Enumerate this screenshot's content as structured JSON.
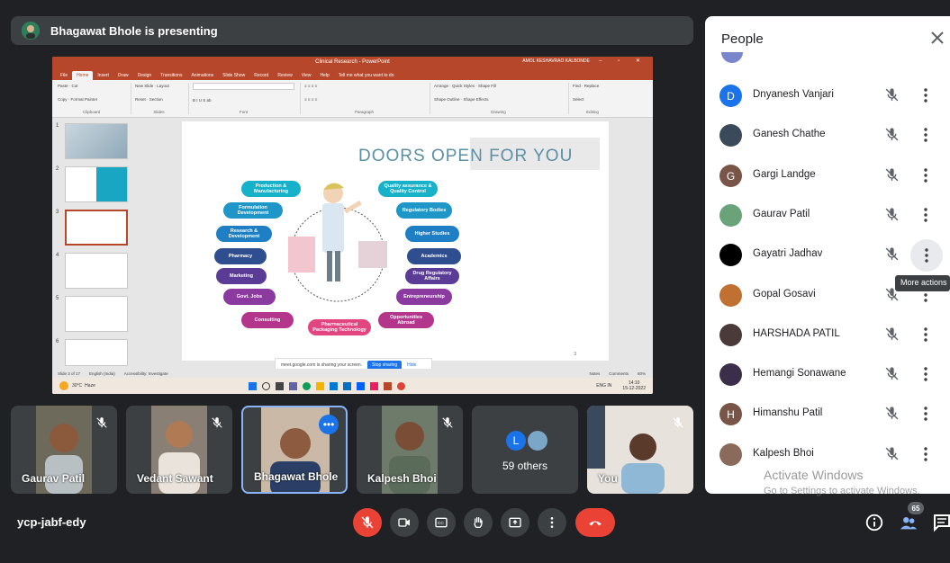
{
  "presenter": {
    "banner_text": "Bhagawat Bhole is presenting"
  },
  "screen": {
    "ppt_window_title": "Clinical Research - PowerPoint",
    "ppt_user": "AMOL KESHAVRAO KALBONDE",
    "ppt_tabs": [
      "File",
      "Home",
      "Insert",
      "Draw",
      "Design",
      "Transitions",
      "Animations",
      "Slide Show",
      "Record",
      "Review",
      "View",
      "Help"
    ],
    "ppt_tell_me": "Tell me what you want to do",
    "ribbon": {
      "clipboard": "Clipboard",
      "slides": "Slides",
      "font": "Font",
      "paragraph": "Paragraph",
      "drawing": "Drawing",
      "editing": "Editing",
      "paste": "Paste",
      "cut": "Cut",
      "copy": "Copy",
      "format_painter": "Format Painter",
      "new_slide": "New Slide",
      "layout": "Layout",
      "reset": "Reset",
      "section": "Section",
      "arrange": "Arrange",
      "quick_styles": "Quick Styles",
      "shape_fill": "Shape Fill",
      "shape_outline": "Shape Outline",
      "shape_effects": "Shape Effects",
      "find": "Find",
      "replace": "Replace",
      "select": "Select"
    },
    "thumb_numbers": [
      "1",
      "2",
      "3",
      "4",
      "5",
      "6"
    ],
    "slide": {
      "title": "DOORS OPEN FOR YOU",
      "left_items": [
        "Production & Manufacturing",
        "Formulation Development",
        "Research & Development",
        "Pharmacy",
        "Marketing",
        "Govt. Jobs",
        "Consulting"
      ],
      "right_items": [
        "Quality assurance & Quality Control",
        "Regulatory Bodies",
        "Higher Studies",
        "Academics",
        "Drug Regulatory Affairs",
        "Entrepreneurship",
        "Opportunities Abroad"
      ],
      "bottom_item": "Pharmaceutical Packaging Technology",
      "page_number": "3",
      "colors": {
        "teal": "#17b1c9",
        "blue": "#1f7fc4",
        "navy": "#2f4e8f",
        "purple": "#5a3c97",
        "magenta": "#b3368c",
        "pink": "#e2457f"
      }
    },
    "status": {
      "slide_count": "Slide 3 of 17",
      "language": "English (India)",
      "accessibility": "Accessibility: Investigate",
      "notes": "Notes",
      "comments": "Comments",
      "zoom": "60%"
    },
    "share_notice": {
      "text": "meet.google.com is sharing your screen.",
      "stop": "Stop sharing",
      "hide": "Hide"
    },
    "taskbar": {
      "weather_temp": "30°C",
      "weather_desc": "Haze",
      "lang": "ENG IN",
      "time": "14:10",
      "date": "15-12-2022"
    }
  },
  "tiles": [
    {
      "name": "Gaurav Patil",
      "muted": true
    },
    {
      "name": "Vedant Sawant",
      "muted": true
    },
    {
      "name": "Bhagawat Bhole",
      "muted": false,
      "speaking": true
    },
    {
      "name": "Kalpesh Bhoi",
      "muted": true
    },
    {
      "name": "59 others",
      "avatar_letter": "L"
    },
    {
      "name": "You",
      "muted": true
    }
  ],
  "people_panel": {
    "title": "People",
    "participants": [
      {
        "name": "Dnyanesh Vanjari",
        "initial": "D",
        "color": "#1a73e8"
      },
      {
        "name": "Ganesh Chathe",
        "initial": "",
        "color": "#3b4a5a"
      },
      {
        "name": "Gargi Landge",
        "initial": "G",
        "color": "#795548"
      },
      {
        "name": "Gaurav Patil",
        "initial": "",
        "color": "#6aa37a"
      },
      {
        "name": "Gayatri Jadhav",
        "initial": "",
        "color": "#000000"
      },
      {
        "name": "Gopal Gosavi",
        "initial": "",
        "color": "#c07030"
      },
      {
        "name": "HARSHADA PATIL",
        "initial": "",
        "color": "#4a3a3a"
      },
      {
        "name": "Hemangi Sonawane",
        "initial": "",
        "color": "#3a2e4a"
      },
      {
        "name": "Himanshu Patil",
        "initial": "H",
        "color": "#795548"
      },
      {
        "name": "Kalpesh Bhoi",
        "initial": "",
        "color": "#8a6a5a"
      }
    ],
    "tooltip": "More actions",
    "watermark_title": "Activate Windows",
    "watermark_sub": "Go to Settings to activate Windows."
  },
  "bottom_bar": {
    "meeting_code": "ycp-jabf-edy",
    "people_count": "65"
  }
}
